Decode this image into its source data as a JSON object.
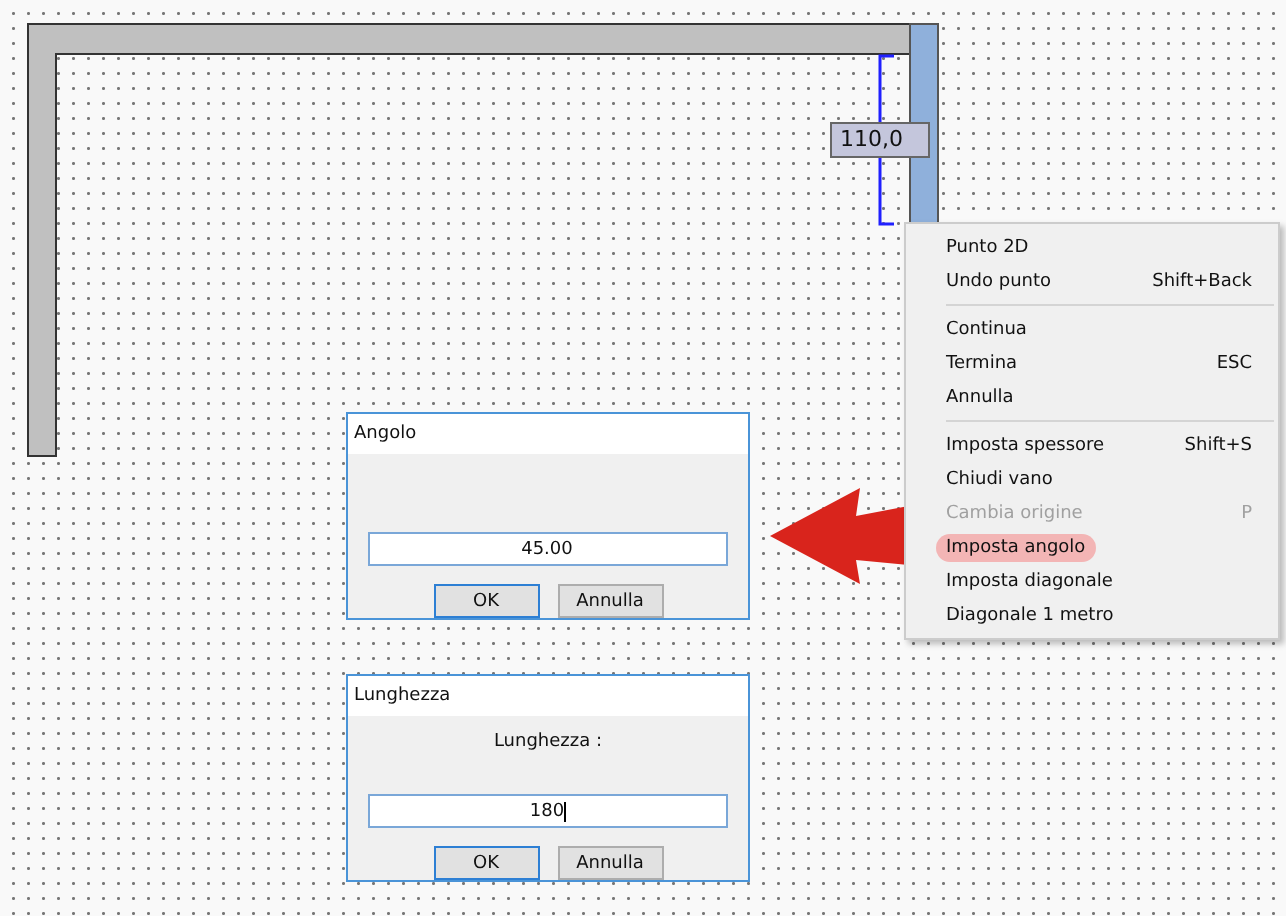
{
  "drawing": {
    "dimension_label": "110,0"
  },
  "dialogs": [
    {
      "title": "Angolo",
      "value": "45.00",
      "text_cursor": false,
      "buttons": [
        "OK",
        "Annulla"
      ]
    },
    {
      "title": "Lunghezza",
      "prompt": "Lunghezza :",
      "value": "180",
      "text_cursor": true,
      "buttons": [
        "OK",
        "Annulla"
      ]
    }
  ],
  "context_menu": {
    "groups": [
      [
        {
          "label": "Punto 2D",
          "disabled": false,
          "selected": false
        },
        {
          "label": "Undo punto",
          "shortcut": "Shift+Back",
          "disabled": false,
          "selected": false
        }
      ],
      [
        {
          "label": "Continua",
          "disabled": false,
          "selected": false
        },
        {
          "label": "Termina",
          "shortcut": "ESC",
          "disabled": false,
          "selected": false
        },
        {
          "label": "Annulla",
          "disabled": false,
          "selected": false
        }
      ],
      [
        {
          "label": "Imposta spessore",
          "shortcut": "Shift+S",
          "disabled": false,
          "selected": false
        },
        {
          "label": "Chiudi vano",
          "disabled": false,
          "selected": false
        },
        {
          "label": "Cambia origine",
          "shortcut": "P",
          "disabled": true,
          "selected": false
        },
        {
          "label": "Imposta angolo",
          "disabled": false,
          "selected": true
        },
        {
          "label": "Imposta diagonale",
          "disabled": false,
          "selected": false
        },
        {
          "label": "Diagonale 1 metro",
          "disabled": false,
          "selected": false
        }
      ]
    ]
  }
}
